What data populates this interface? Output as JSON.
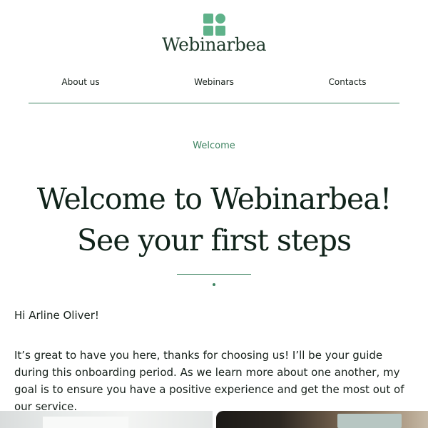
{
  "brand": {
    "name": "Webinarbea",
    "logo_icon": "four-squares-logo-icon",
    "accent_color": "#5fb28a"
  },
  "nav": {
    "items": [
      {
        "label": "About us"
      },
      {
        "label": "Webinars"
      },
      {
        "label": "Contacts"
      }
    ]
  },
  "hero": {
    "eyebrow": "Welcome",
    "title_line1": "Welcome to Webinarbea!",
    "title_line2": "See your first steps"
  },
  "content": {
    "greeting": "Hi Arline Oliver!",
    "paragraph": "It’s great to have you here, thanks for choosing us! I’ll be your guide during this onboarding period. As we learn more about one another, my goal is to ensure you have a positive experience and get the most out of our service."
  },
  "colors": {
    "accent_green": "#3f8462",
    "text_dark": "#16201a"
  }
}
